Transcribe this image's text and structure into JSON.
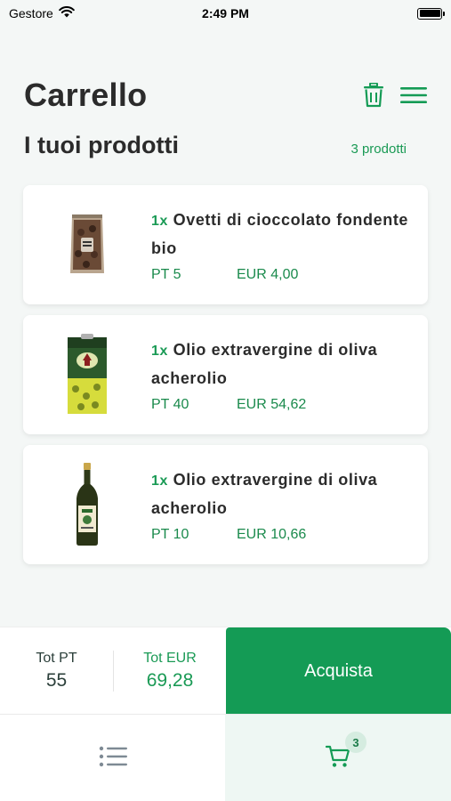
{
  "status_bar": {
    "carrier": "Gestore",
    "time": "2:49 PM"
  },
  "header": {
    "title": "Carrello"
  },
  "section": {
    "title": "I tuoi prodotti",
    "count": "3 prodotti"
  },
  "cart": {
    "items": [
      {
        "qty": "1x",
        "name": "Ovetti di cioccolato fondente bio",
        "pt": "PT 5",
        "eur": "EUR 4,00",
        "image": "chocolate-bag-image"
      },
      {
        "qty": "1x",
        "name": "Olio extravergine di oliva acherolio",
        "pt": "PT 40",
        "eur": "EUR 54,62",
        "image": "olive-oil-tin-image"
      },
      {
        "qty": "1x",
        "name": "Olio extravergine di oliva acherolio",
        "pt": "PT 10",
        "eur": "EUR 10,66",
        "image": "olive-oil-bottle-image"
      }
    ]
  },
  "totals": {
    "pt_label": "Tot PT",
    "pt_value": "55",
    "eur_label": "Tot EUR",
    "eur_value": "69,28"
  },
  "checkout": {
    "label": "Acquista"
  },
  "tab_bar": {
    "cart_badge": "3"
  },
  "colors": {
    "accent": "#149b55",
    "text_dark": "#2b2b2b",
    "background": "#f4f7f6"
  },
  "icons": [
    "wifi-icon",
    "battery-icon",
    "trash-icon",
    "menu-icon",
    "list-icon",
    "cart-icon"
  ]
}
